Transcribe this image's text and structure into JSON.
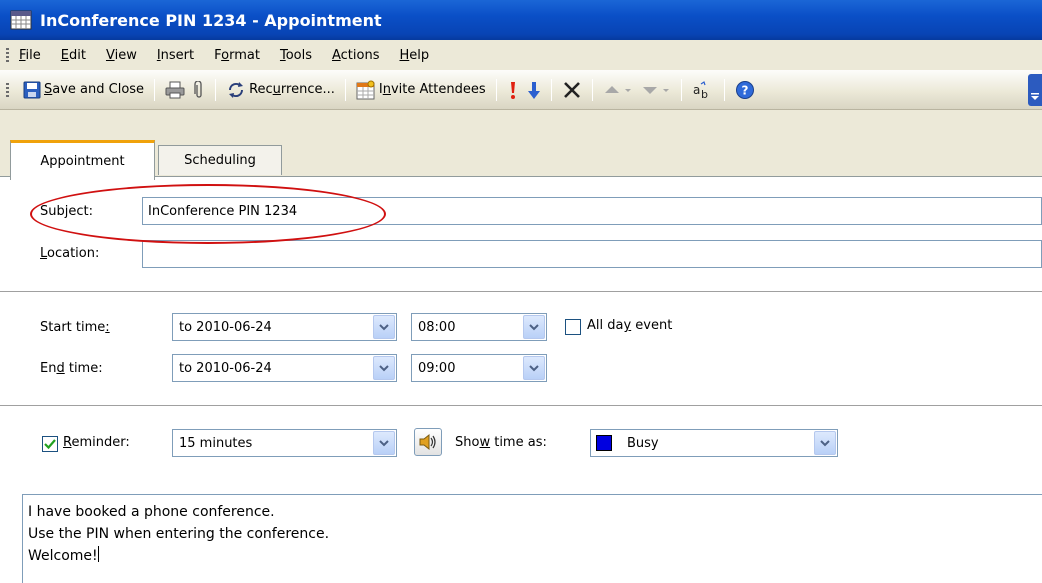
{
  "window": {
    "title": "InConference PIN 1234 - Appointment"
  },
  "menu": {
    "items": [
      {
        "pre": "",
        "key": "F",
        "post": "ile"
      },
      {
        "pre": "",
        "key": "E",
        "post": "dit"
      },
      {
        "pre": "",
        "key": "V",
        "post": "iew"
      },
      {
        "pre": "",
        "key": "I",
        "post": "nsert"
      },
      {
        "pre": "F",
        "key": "o",
        "post": "rmat"
      },
      {
        "pre": "",
        "key": "T",
        "post": "ools"
      },
      {
        "pre": "",
        "key": "A",
        "post": "ctions"
      },
      {
        "pre": "",
        "key": "H",
        "post": "elp"
      }
    ]
  },
  "toolbar": {
    "save_close": {
      "pre": "",
      "key": "S",
      "post": "ave and Close"
    },
    "recurrence": {
      "pre": "Rec",
      "key": "u",
      "post": "rrence..."
    },
    "invite": {
      "pre": "I",
      "key": "n",
      "post": "vite Attendees"
    }
  },
  "tabs": {
    "appointment": "Appointment",
    "scheduling": "Scheduling"
  },
  "form": {
    "subject_label": {
      "pre": "Sub",
      "key": "j",
      "post": "ect:"
    },
    "subject_value": "InConference PIN 1234",
    "location_label": {
      "pre": "",
      "key": "L",
      "post": "ocation:"
    },
    "location_value": "",
    "start_label": {
      "pre": "Start time",
      "key": ":",
      "post": ""
    },
    "start_date": "to 2010-06-24",
    "start_time": "08:00",
    "allday_label": {
      "pre": "All da",
      "key": "y",
      "post": " event"
    },
    "allday_checked": false,
    "end_label": {
      "pre": "En",
      "key": "d",
      "post": " time:"
    },
    "end_date": "to 2010-06-24",
    "end_time": "09:00",
    "reminder_label": {
      "pre": "",
      "key": "R",
      "post": "eminder:"
    },
    "reminder_checked": true,
    "reminder_value": "15 minutes",
    "showas_label": {
      "pre": "Sho",
      "key": "w",
      "post": " time as:"
    },
    "showas_value": "Busy",
    "busy_color": "#0000e0"
  },
  "body": {
    "lines": [
      "I have booked a phone conference.",
      "Use the PIN when entering the conference.",
      "Welcome!"
    ]
  },
  "colors": {
    "titlebar": "#0a4fc7",
    "tab_accent": "#f0a20b",
    "highlight_oval": "#d01010"
  }
}
